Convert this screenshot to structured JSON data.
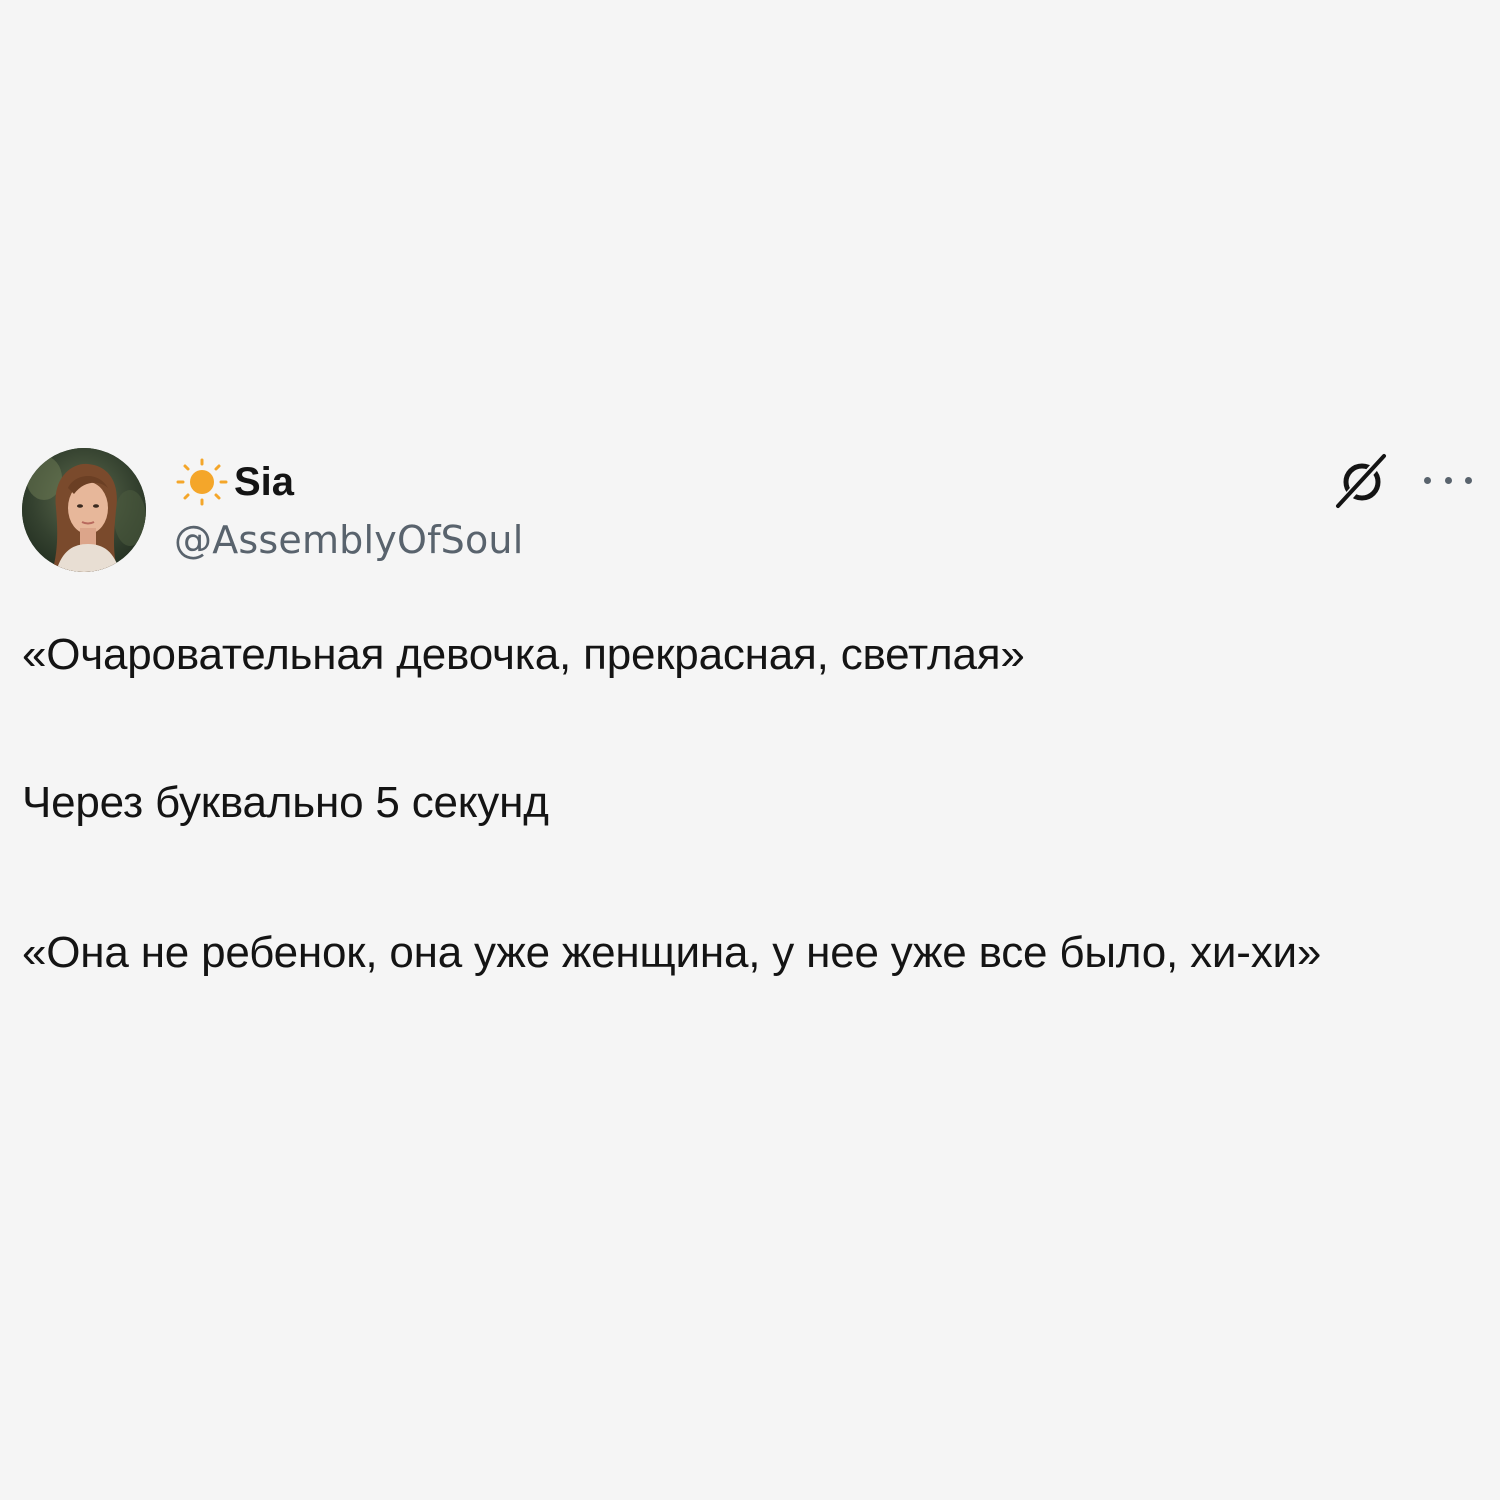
{
  "tweet": {
    "author": {
      "emoji_icon": "sun-icon",
      "name": "Sia",
      "handle": "@AssemblyOfSoul"
    },
    "actions": {
      "grok_icon": "grok-icon",
      "more_icon": "more-horizontal-icon"
    },
    "paragraphs": [
      "«Очаровательная девочка, прекрасная, светлая»",
      "Через буквально 5 секунд",
      "«Она не ребенок, она уже женщина, у нее уже все было, хи-хи»"
    ]
  },
  "colors": {
    "background": "#f5f5f5",
    "text": "#141414",
    "secondary_text": "#59636d",
    "sun": "#f4a62a"
  }
}
